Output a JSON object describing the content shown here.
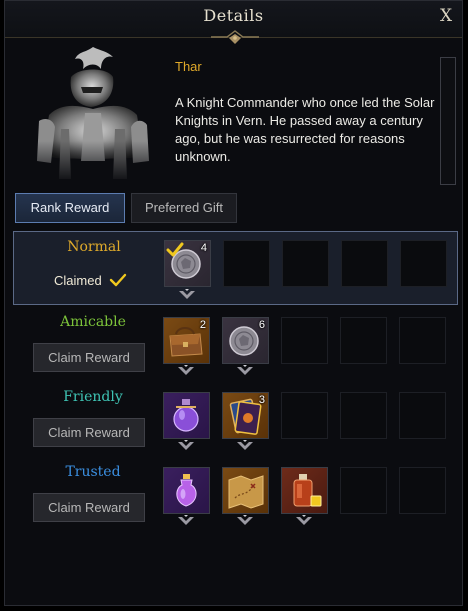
{
  "window": {
    "title": "Details",
    "close_label": "X"
  },
  "npc": {
    "name": "Thar",
    "description": "A Knight Commander who once led the Solar Knights in Vern. He passed away a century ago, but he was resurrected for reasons unknown."
  },
  "tabs": [
    {
      "label": "Rank Reward",
      "active": true
    },
    {
      "label": "Preferred Gift",
      "active": false
    }
  ],
  "ranks": [
    {
      "name": "Normal",
      "color": "#e0ab2b",
      "status": "claimed",
      "claimed_label": "Claimed",
      "rewards": [
        {
          "icon": "silver-coin-icon",
          "quantity": "4",
          "claimed": true
        }
      ]
    },
    {
      "name": "Amicable",
      "color": "#7cc33a",
      "status": "unclaimed",
      "button_label": "Claim Reward",
      "rewards": [
        {
          "icon": "leather-satchel-icon",
          "quantity": "2"
        },
        {
          "icon": "silver-coin-icon",
          "quantity": "6"
        }
      ]
    },
    {
      "name": "Friendly",
      "color": "#3fc4b4",
      "status": "unclaimed",
      "button_label": "Claim Reward",
      "rewards": [
        {
          "icon": "purple-potion-icon",
          "quantity": ""
        },
        {
          "icon": "card-pack-icon",
          "quantity": "3"
        }
      ]
    },
    {
      "name": "Trusted",
      "color": "#3b8fe0",
      "status": "unclaimed",
      "button_label": "Claim Reward",
      "rewards": [
        {
          "icon": "potion-bottle-icon",
          "quantity": ""
        },
        {
          "icon": "treasure-map-icon",
          "quantity": ""
        },
        {
          "icon": "perfume-bottle-icon",
          "quantity": ""
        }
      ]
    }
  ],
  "colors": {
    "accent_gold": "#e0a92a",
    "active_tab_border": "#5c7cb0",
    "check": "#f0c81e"
  }
}
